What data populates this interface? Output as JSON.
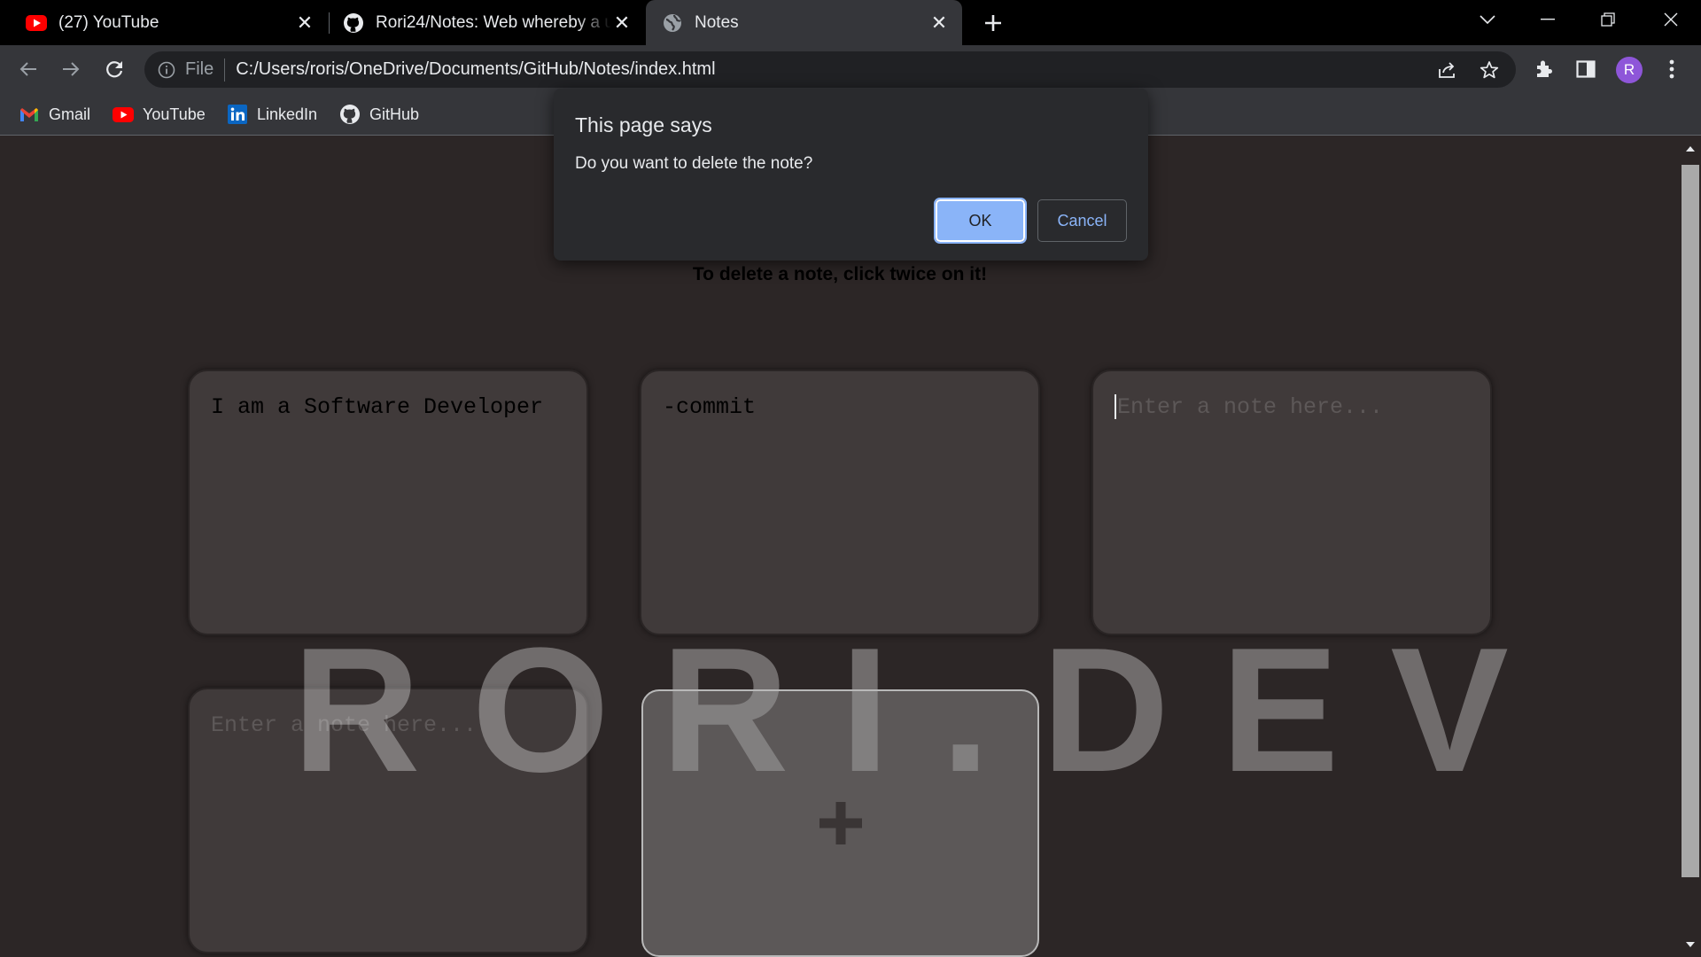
{
  "browser": {
    "tabs": [
      {
        "title": "(27) YouTube",
        "icon": "youtube-icon",
        "active": false
      },
      {
        "title": "Rori24/Notes: Web whereby a us",
        "icon": "github-icon",
        "active": false
      },
      {
        "title": "Notes",
        "icon": "globe-icon",
        "active": true
      }
    ],
    "address": {
      "scheme_label": "File",
      "url": "C:/Users/roris/OneDrive/Documents/GitHub/Notes/index.html"
    },
    "profile_initial": "R",
    "colors": {
      "titlebar": "#000000",
      "toolbar": "#35363a",
      "omnibox": "#202124",
      "avatar": "#8e56d9"
    }
  },
  "bookmarks": [
    {
      "label": "Gmail",
      "icon": "gmail-icon"
    },
    {
      "label": "YouTube",
      "icon": "youtube-icon"
    },
    {
      "label": "LinkedIn",
      "icon": "linkedin-icon"
    },
    {
      "label": "GitHub",
      "icon": "github-icon"
    }
  ],
  "page": {
    "instruction": "To delete a note, click twice on it!",
    "watermark": "RORI.DEV",
    "notes": [
      {
        "text": "I am a Software Developer",
        "placeholder": ""
      },
      {
        "text": "-commit",
        "placeholder": ""
      },
      {
        "text": "",
        "placeholder": "Enter a note here..."
      },
      {
        "text": "",
        "placeholder": "Enter a note here..."
      }
    ],
    "add_button_symbol": "+",
    "colors": {
      "background": "#2c2626",
      "note": "#403a3a"
    }
  },
  "dialog": {
    "title": "This page says",
    "message": "Do you want to delete the note?",
    "ok_label": "OK",
    "cancel_label": "Cancel",
    "colors": {
      "accent": "#8ab4f8",
      "background": "#292a2d"
    }
  }
}
